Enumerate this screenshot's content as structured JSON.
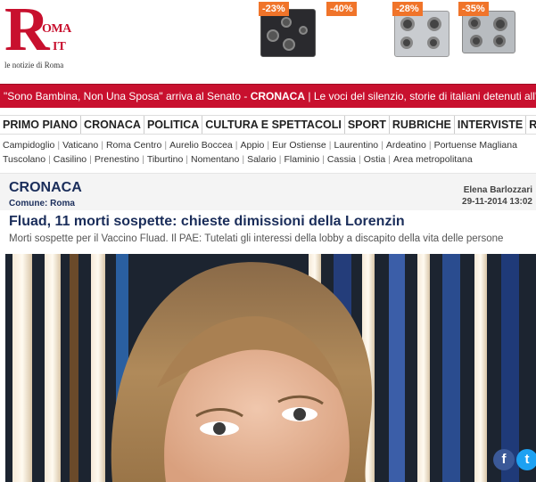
{
  "logo": {
    "letter": "R",
    "roma": "OMA",
    "it": "IT",
    "tagline": "le notizie di Roma"
  },
  "ads": [
    {
      "discount": "-23%",
      "product": "black cooktop"
    },
    {
      "discount": "-40%",
      "product": ""
    },
    {
      "discount": "-28%",
      "product": "steel cooktop"
    },
    {
      "discount": "-35%",
      "product": "steel cooktop"
    }
  ],
  "ticker": {
    "headline1": "\"Sono Bambina, Non Una Sposa\" arriva al Senato - ",
    "tag1": "CRONACA",
    "sep": " | ",
    "headline2": "Le voci del silenzio, storie di italiani detenuti all'estero - C"
  },
  "mainnav": [
    "PRIMO PIANO",
    "CRONACA",
    "POLITICA",
    "CULTURA E SPETTACOLI",
    "SPORT",
    "RUBRICHE",
    "INTERVISTE",
    "ROMA DI NO"
  ],
  "subnav_row1": [
    "Campidoglio",
    "Vaticano",
    "Roma Centro",
    "Aurelio Boccea",
    "Appio",
    "Eur Ostiense",
    "Laurentino",
    "Ardeatino",
    "Portuense Magliana"
  ],
  "subnav_row2": [
    "Tuscolano",
    "Casilino",
    "Prenestino",
    "Tiburtino",
    "Nomentano",
    "Salario",
    "Flaminio",
    "Cassia",
    "Ostia",
    "Area metropolitana"
  ],
  "article": {
    "section": "CRONACA",
    "comune_label": "Comune:",
    "comune_value": "Roma",
    "author": "Elena Barlozzari",
    "date": "29-11-2014 13:02",
    "headline": "Fluad, 11 morti sospette: chieste dimissioni della Lorenzin",
    "subtitle": "Morti sospette per il Vaccino Fluad. Il PAE: Tutelati gli interessi della lobby a discapito della vita delle persone"
  },
  "social": {
    "facebook": "f",
    "twitter": "t"
  },
  "colors": {
    "brand": "#c8102e",
    "navy": "#1a2d5a",
    "ad_badge": "#f0742a",
    "facebook": "#3b5998",
    "twitter": "#1da1f2"
  }
}
